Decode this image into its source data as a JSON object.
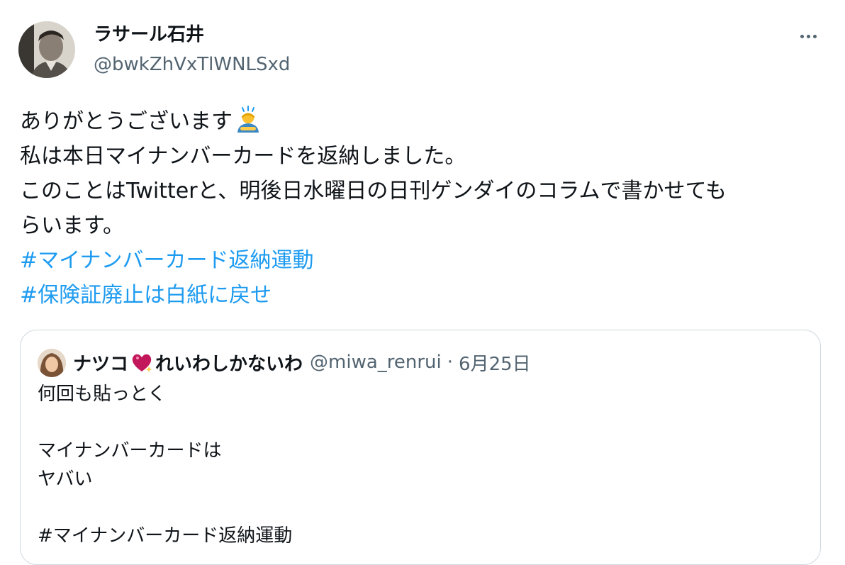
{
  "author": {
    "name": "ラサール石井",
    "handle": "@bwkZhVxTlWNLSxd"
  },
  "more_icon": "more-horizontal-icon",
  "tweet": {
    "lines": [
      "ありがとうございます",
      "私は本日マイナンバーカードを返納しました。",
      "このことはTwitterと、明後日水曜日の日刊ゲンダイのコラムで書かせても",
      "らいます。"
    ],
    "emoji": "bowing-person-emoji",
    "hashtags": [
      "#マイナンバーカード返納運動",
      "#保険証廃止は白紙に戻せ"
    ]
  },
  "quote": {
    "name_a": "ナツコ",
    "name_b": "れいわしかないわ",
    "name_emoji": "sparkling-heart-icon",
    "handle": "@miwa_renrui",
    "separator": "·",
    "date": "6月25日",
    "lines": [
      "何回も貼っとく",
      "",
      "マイナンバーカードは",
      "ヤバい",
      "",
      "#マイナンバーカード返納運動"
    ]
  },
  "colors": {
    "link": "#1d9bf0",
    "secondary_text": "#536471",
    "border": "#cfd9de"
  }
}
